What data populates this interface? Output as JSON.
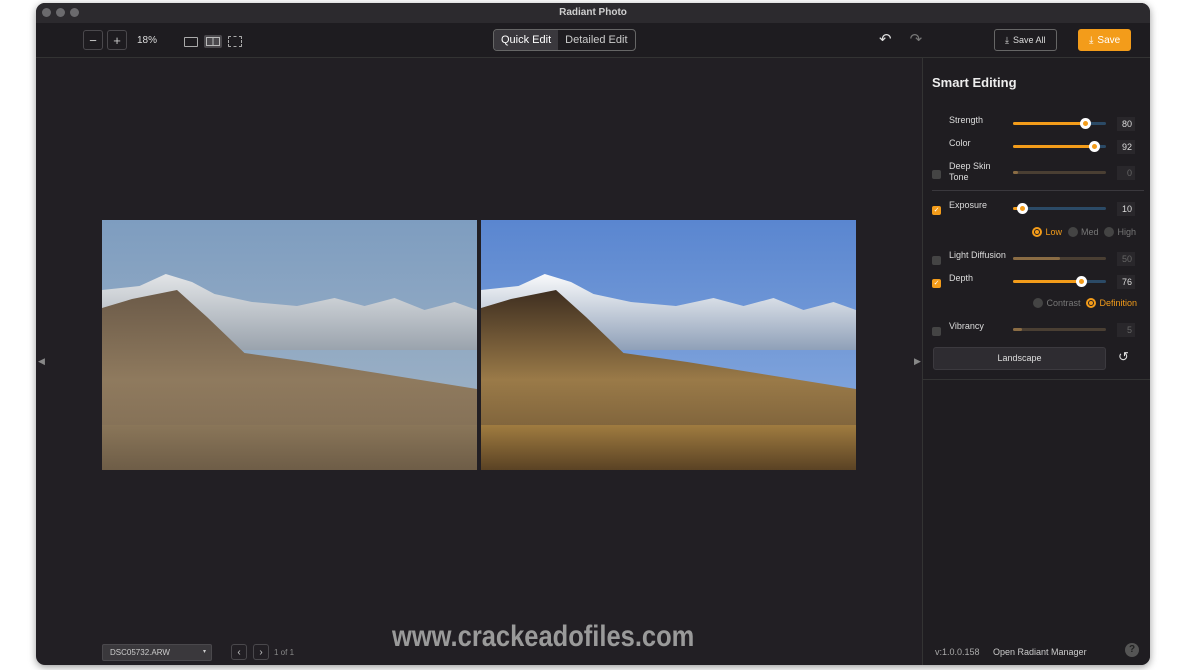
{
  "window": {
    "title": "Radiant Photo"
  },
  "toolbar": {
    "zoom_out": "−",
    "zoom_in": "+",
    "zoom_level": "18%",
    "tabs": [
      {
        "label": "Quick Edit",
        "active": true
      },
      {
        "label": "Detailed Edit",
        "active": false
      }
    ],
    "save_all": "Save All",
    "save": "Save"
  },
  "panel": {
    "title": "Smart Editing",
    "sliders": [
      {
        "label": "Strength",
        "value": "80",
        "enabled": true
      },
      {
        "label": "Color",
        "value": "92",
        "enabled": true
      },
      {
        "label": "Deep Skin Tone",
        "value": "0",
        "enabled": false
      },
      {
        "label": "Exposure",
        "value": "10",
        "enabled": true
      },
      {
        "label": "Light Diffusion",
        "value": "50",
        "enabled": false
      },
      {
        "label": "Depth",
        "value": "76",
        "enabled": true
      },
      {
        "label": "Vibrancy",
        "value": "5",
        "enabled": false
      }
    ],
    "exposure_options": [
      "Low",
      "Med",
      "High"
    ],
    "exposure_selected": "Low",
    "depth_options": [
      "Contrast",
      "Definition"
    ],
    "depth_selected": "Definition",
    "preset": "Landscape"
  },
  "bottom": {
    "file": "DSC05732.ARW",
    "page": "1 of 1",
    "version": "v:1.0.0.158",
    "manager": "Open Radiant Manager",
    "help": "?"
  },
  "watermark": "www.crackeadofiles.com",
  "colors": {
    "accent": "#f39c1a",
    "background": "#221f24"
  }
}
